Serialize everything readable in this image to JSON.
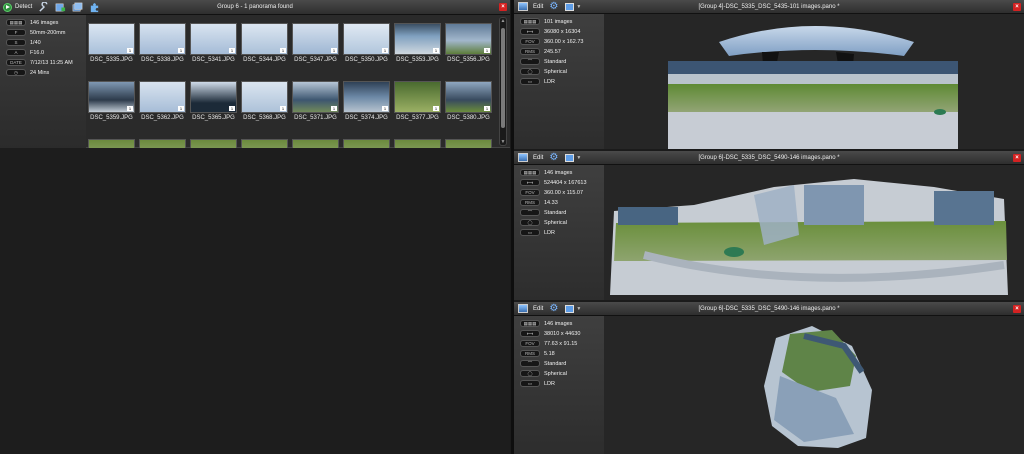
{
  "left": {
    "toolbar": {
      "detect_label": "Detect",
      "title": "Group 6 - 1 panorama found",
      "close": "×"
    },
    "info": [
      {
        "key": "",
        "icon": "grid-icon",
        "value": "146 images"
      },
      {
        "key": "F",
        "value": "50mm-200mm"
      },
      {
        "key": "S",
        "value": "1/40"
      },
      {
        "key": "A",
        "value": "F16.0"
      },
      {
        "key": "DATE",
        "value": "7/12/13 11:25 AM"
      },
      {
        "key": "",
        "icon": "clock-icon",
        "value": "24 Mins"
      }
    ],
    "thumbnails": [
      {
        "label": "DSC_5335.JPG",
        "badge": "1"
      },
      {
        "label": "DSC_5338.JPG",
        "badge": "1"
      },
      {
        "label": "DSC_5341.JPG",
        "badge": "1"
      },
      {
        "label": "DSC_5344.JPG",
        "badge": "1"
      },
      {
        "label": "DSC_5347.JPG",
        "badge": "1"
      },
      {
        "label": "DSC_5350.JPG",
        "badge": "1"
      },
      {
        "label": "DSC_5353.JPG",
        "badge": "1"
      },
      {
        "label": "DSC_5356.JPG",
        "badge": "1"
      },
      {
        "label": "DSC_5359.JPG",
        "badge": "1"
      },
      {
        "label": "DSC_5362.JPG",
        "badge": "1"
      },
      {
        "label": "DSC_5365.JPG",
        "badge": "1"
      },
      {
        "label": "DSC_5368.JPG",
        "badge": "1"
      },
      {
        "label": "DSC_5371.JPG",
        "badge": "1"
      },
      {
        "label": "DSC_5374.JPG",
        "badge": "1"
      },
      {
        "label": "DSC_5377.JPG",
        "badge": "1"
      },
      {
        "label": "DSC_5380.JPG",
        "badge": "1"
      }
    ]
  },
  "panes": [
    {
      "title": "[Group 4]-DSC_5335_DSC_5435-101 images.pano *",
      "edit_label": "Edit",
      "info": [
        {
          "key": "",
          "value": "101 images"
        },
        {
          "key": "",
          "value": "36080 x 16304"
        },
        {
          "key": "FOV",
          "value": "360.00 x 162.73"
        },
        {
          "key": "RMS",
          "value": "245.57"
        },
        {
          "key": "",
          "value": "Standard"
        },
        {
          "key": "",
          "value": "Spherical"
        },
        {
          "key": "",
          "value": "LDR"
        }
      ]
    },
    {
      "title": "[Group 6]-DSC_5335_DSC_5490-146 images.pano *",
      "edit_label": "Edit",
      "info": [
        {
          "key": "",
          "value": "146 images"
        },
        {
          "key": "",
          "value": "524404 x 167613"
        },
        {
          "key": "FOV",
          "value": "360.00 x 115.07"
        },
        {
          "key": "RMS",
          "value": "14.33"
        },
        {
          "key": "",
          "value": "Standard"
        },
        {
          "key": "",
          "value": "Spherical"
        },
        {
          "key": "",
          "value": "LDR"
        }
      ]
    },
    {
      "title": "[Group 6]-DSC_5335_DSC_5490-146 images.pano *",
      "edit_label": "Edit",
      "info": [
        {
          "key": "",
          "value": "146 images"
        },
        {
          "key": "",
          "value": "38010 x 44630"
        },
        {
          "key": "FOV",
          "value": "77.63 x 91.15"
        },
        {
          "key": "RMS",
          "value": "5.18"
        },
        {
          "key": "",
          "value": "Standard"
        },
        {
          "key": "",
          "value": "Spherical"
        },
        {
          "key": "",
          "value": "LDR"
        }
      ]
    }
  ],
  "colors": {
    "close": "#d42222",
    "accent": "#5d9ce6",
    "panel": "#2a2a2a"
  }
}
